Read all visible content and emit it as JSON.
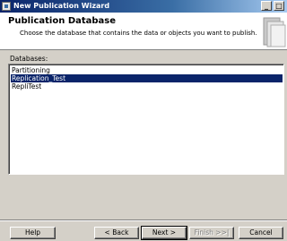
{
  "window": {
    "title": "New Publication Wizard",
    "controls": {
      "minimize": "_",
      "maximize": "□"
    }
  },
  "header": {
    "title": "Publication Database",
    "subtitle": "Choose the database that contains the data or objects you want to publish."
  },
  "databases": {
    "label": "Databases:",
    "items": [
      {
        "label": "Partitioning",
        "selected": false
      },
      {
        "label": "Replication_Test",
        "selected": true
      },
      {
        "label": "RepliTest",
        "selected": false
      }
    ]
  },
  "buttons": {
    "help": "Help",
    "back": "< Back",
    "next": "Next >",
    "finish": "Finish >>|",
    "cancel": "Cancel"
  },
  "colors": {
    "selection": "#0a246a",
    "titlebar_start": "#0a246a",
    "titlebar_end": "#a6caf0",
    "face": "#d4d0c8"
  }
}
